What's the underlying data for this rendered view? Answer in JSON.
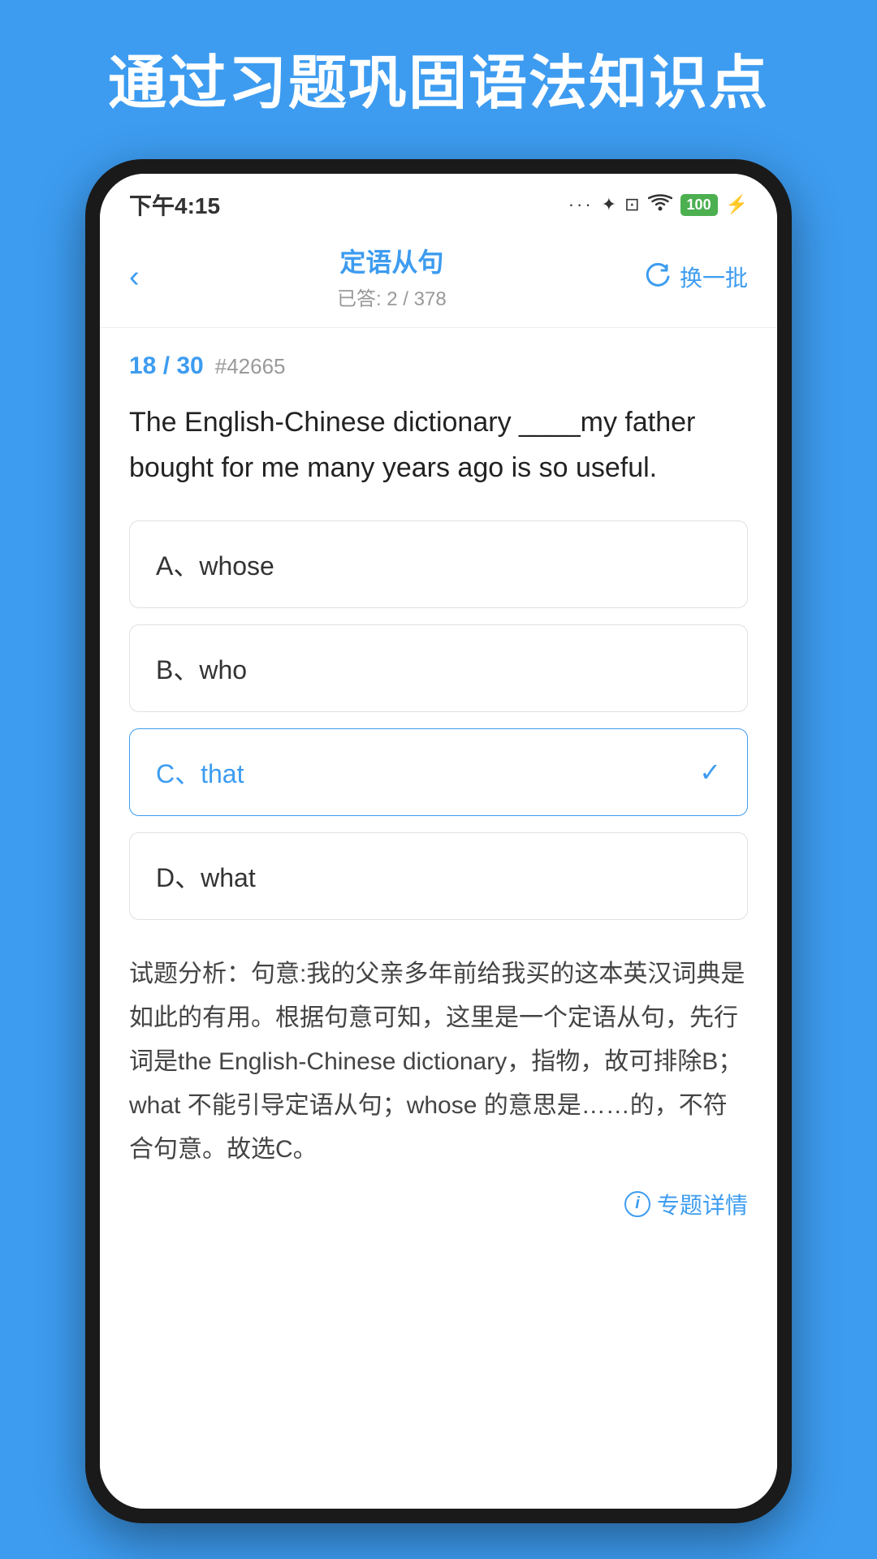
{
  "page": {
    "bg_title": "通过习题巩固语法知识点",
    "status_bar": {
      "time": "下午4:15",
      "dots": "...",
      "bluetooth": "✦",
      "sim": "⊠",
      "wifi": "WiFi",
      "battery": "100"
    },
    "nav": {
      "back_label": "‹",
      "title": "定语从句",
      "subtitle": "已答: 2 / 378",
      "refresh_label": "换一批"
    },
    "question": {
      "progress": "18 / 30",
      "id": "#42665",
      "text": "The English-Chinese dictionary ____my father bought for me many years ago is so useful."
    },
    "options": [
      {
        "label": "A、whose",
        "selected": false
      },
      {
        "label": "B、who",
        "selected": false
      },
      {
        "label": "C、that",
        "selected": true
      },
      {
        "label": "D、what",
        "selected": false
      }
    ],
    "analysis": {
      "title": "试题分析：",
      "text": "句意:我的父亲多年前给我买的这本英汉词典是如此的有用。根据句意可知，这里是一个定语从句，先行词是the English-Chinese dictionary，指物，故可排除B；what 不能引导定语从句；whose 的意思是……的，不符合句意。故选C。"
    },
    "detail_link": "专题详情"
  }
}
